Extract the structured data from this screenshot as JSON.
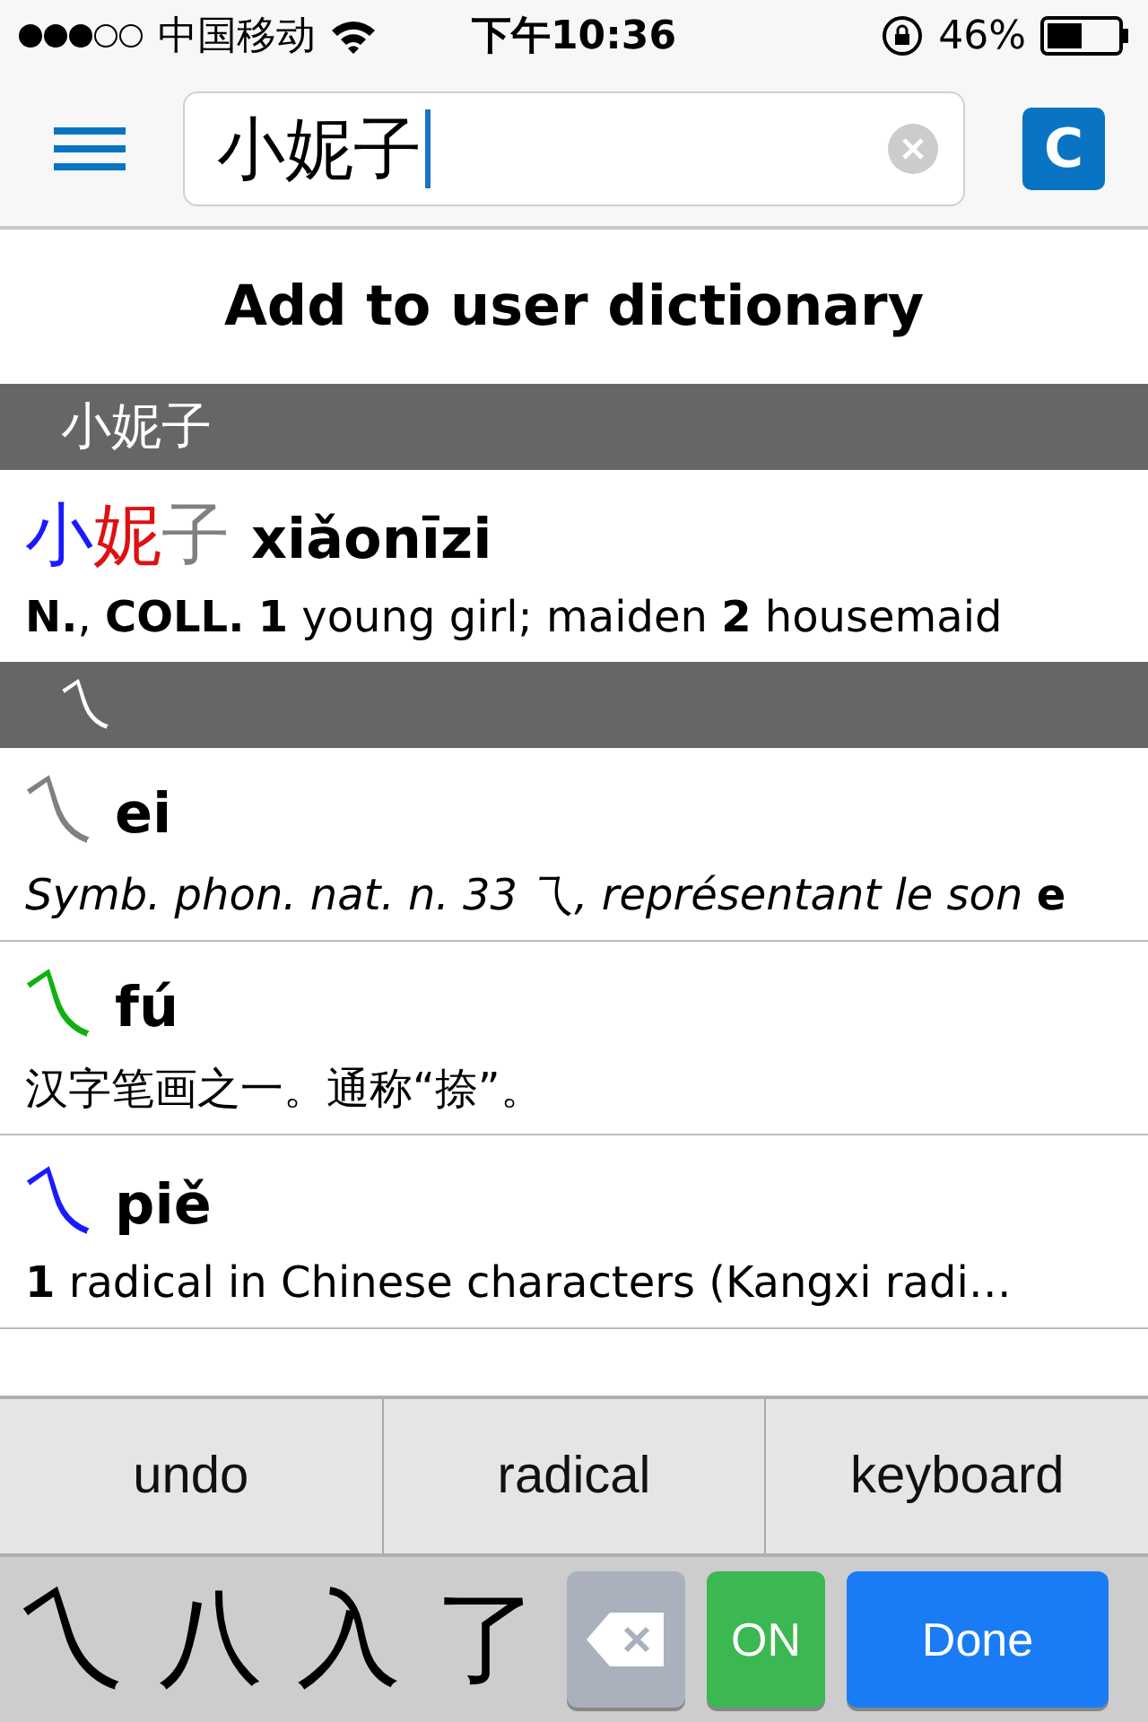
{
  "status_bar": {
    "carrier": "中国移动",
    "time": "下午10:36",
    "battery": "46%"
  },
  "toolbar": {
    "search_value": "小妮子",
    "mode_button": "C"
  },
  "title": "Add to user dictionary",
  "sections": [
    {
      "header": "小妮子",
      "entries": [
        {
          "head": [
            {
              "char": "小",
              "color": "#1a1aff"
            },
            {
              "char": "妮",
              "color": "#e01010"
            },
            {
              "char": "子",
              "color": "#808080"
            }
          ],
          "pinyin": "xiǎonīzi",
          "definition": "**N.**, **COLL.**  **1** young girl; maiden  **2** housemaid"
        }
      ]
    },
    {
      "header": "乀",
      "entries": [
        {
          "head": [
            {
              "char": "乀",
              "color": "#808080"
            }
          ],
          "pinyin": "ei",
          "definition": "*Symb. phon. nat. n. 33 乁, représentant le son* **e**"
        },
        {
          "head": [
            {
              "char": "乀",
              "color": "#10b010"
            }
          ],
          "pinyin": "fú",
          "definition": "汉字笔画之一。通称“捺”。"
        },
        {
          "head": [
            {
              "char": "乀",
              "color": "#1a1aff"
            }
          ],
          "pinyin": "piě",
          "definition": "**1** radical in Chinese characters (Kangxi radi…"
        }
      ]
    }
  ],
  "actions": [
    "undo",
    "radical",
    "keyboard"
  ],
  "keyboard": {
    "candidates": [
      "乀",
      "八",
      "入",
      "了"
    ],
    "toggle": "ON",
    "done": "Done"
  }
}
